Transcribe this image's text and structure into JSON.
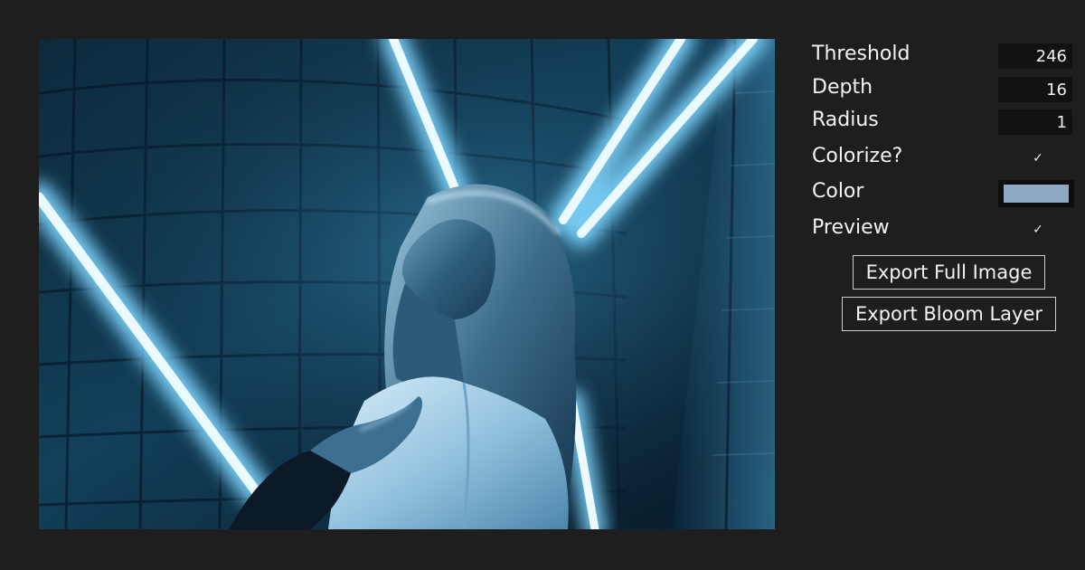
{
  "controls": {
    "threshold": {
      "label": "Threshold",
      "value": "246"
    },
    "depth": {
      "label": "Depth",
      "value": "16"
    },
    "radius": {
      "label": "Radius",
      "value": "1"
    },
    "colorize": {
      "label": "Colorize?",
      "checked": true,
      "check_glyph": "✓"
    },
    "color": {
      "label": "Color",
      "value": "#8fa8c4"
    },
    "preview": {
      "label": "Preview",
      "checked": true,
      "check_glyph": "✓"
    }
  },
  "buttons": {
    "export_full": "Export Full Image",
    "export_bloom": "Export Bloom Layer"
  },
  "colors": {
    "background": "#1e1e1e",
    "input_background": "#121212",
    "tube_glow": "#7fd6ff",
    "tube_core": "#eafaff",
    "wall": "#0e2c40"
  },
  "image": {
    "subject": "woman-with-neon-tubes-photo"
  }
}
